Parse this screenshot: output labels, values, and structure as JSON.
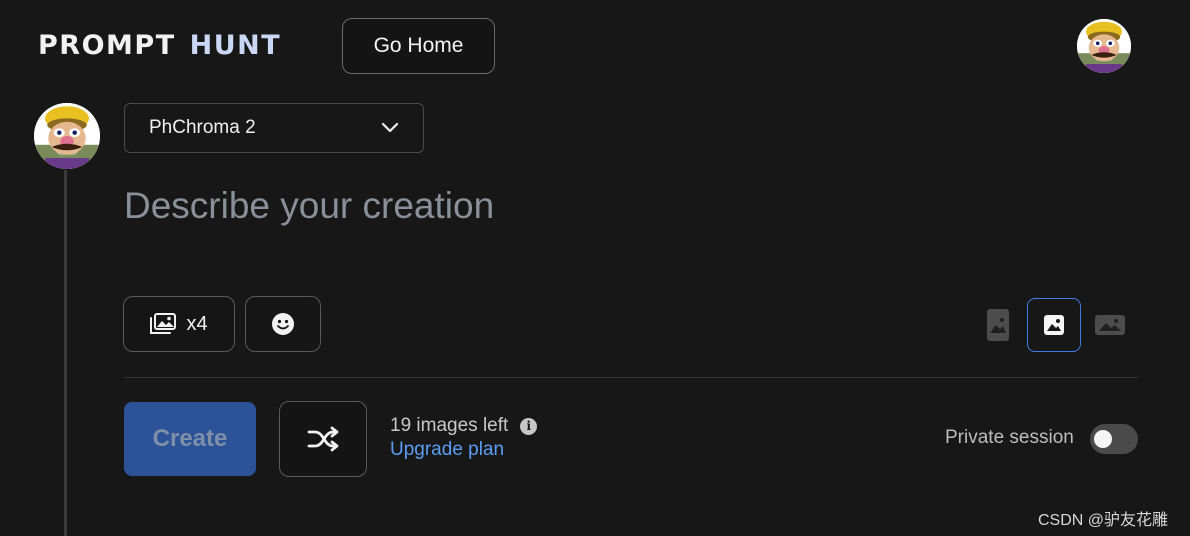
{
  "header": {
    "logo_word1": "PROMPT",
    "logo_word2": "HUNT",
    "go_home_label": "Go Home"
  },
  "composer": {
    "model_selected": "PhChroma 2",
    "prompt_placeholder": "Describe your creation",
    "image_count_label": "x4",
    "aspect_ratios": [
      "portrait",
      "square",
      "landscape"
    ],
    "aspect_selected": "square"
  },
  "actions": {
    "create_label": "Create",
    "images_left": "19 images left",
    "upgrade_label": "Upgrade plan",
    "private_session_label": "Private session",
    "private_session_on": false
  },
  "watermark": "CSDN @驴友花雕",
  "colors": {
    "background": "#171717",
    "accent_blue": "#3f7ce0",
    "create_bg": "#2c5397",
    "link": "#5a9df4"
  },
  "icons": {
    "model_dropdown": "chevron-down-icon",
    "image_count": "images-stack-icon",
    "style": "smiley-icon",
    "shuffle": "shuffle-icon",
    "info": "info-icon"
  }
}
